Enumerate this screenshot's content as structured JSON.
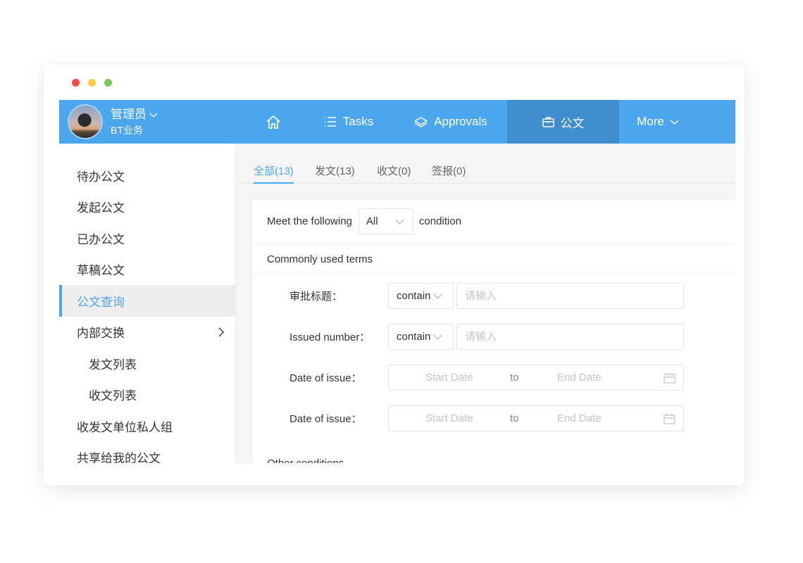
{
  "window": {
    "controls": [
      "close",
      "minimize",
      "maximize"
    ]
  },
  "header": {
    "user": {
      "name": "管理员",
      "org": "BT业务",
      "avatar_icon": "user-avatar-photo"
    },
    "nav": [
      {
        "label": "",
        "icon": "home-icon",
        "active": false
      },
      {
        "label": "Tasks",
        "icon": "list-icon",
        "active": false
      },
      {
        "label": "Approvals",
        "icon": "layers-icon",
        "active": false
      },
      {
        "label": "公文",
        "icon": "briefcase-icon",
        "active": true
      },
      {
        "label": "More",
        "icon": "chevron-down-icon",
        "active": false
      }
    ],
    "colors": {
      "bar": "#4ba6ee",
      "active": "#3f8dcc"
    }
  },
  "sidebar": {
    "items": [
      {
        "label": "待办公文",
        "active": false
      },
      {
        "label": "发起公文",
        "active": false
      },
      {
        "label": "已办公文",
        "active": false
      },
      {
        "label": "草稿公文",
        "active": false
      },
      {
        "label": "公文查询",
        "active": true
      },
      {
        "label": "内部交换",
        "active": false,
        "expandable": true
      },
      {
        "label": "发文列表",
        "active": false,
        "sub": true
      },
      {
        "label": "收文列表",
        "active": false,
        "sub": true
      },
      {
        "label": "收发文单位私人组",
        "active": false
      },
      {
        "label": "共享给我的公文",
        "active": false
      }
    ]
  },
  "main": {
    "tabs": [
      {
        "label": "全部(13)",
        "active": true
      },
      {
        "label": "发文(13)",
        "active": false
      },
      {
        "label": "收文(0)",
        "active": false
      },
      {
        "label": "签报(0)",
        "active": false
      }
    ],
    "condition": {
      "prefix": "Meet the following",
      "selected": "All",
      "suffix": "condition"
    },
    "common_section": "Commonly used terms",
    "fields": [
      {
        "label": "审批标题：",
        "operator": "contain",
        "placeholder": "请输入",
        "value": ""
      },
      {
        "label": "Issued number：",
        "operator": "contain",
        "placeholder": "请输入",
        "value": ""
      }
    ],
    "date_fields": [
      {
        "label": "Date of issue：",
        "start_placeholder": "Start Date",
        "separator": "to",
        "end_placeholder": "End Date"
      },
      {
        "label": "Date of issue：",
        "start_placeholder": "Start Date",
        "separator": "to",
        "end_placeholder": "End Date"
      }
    ],
    "other_section": "Other conditions"
  }
}
